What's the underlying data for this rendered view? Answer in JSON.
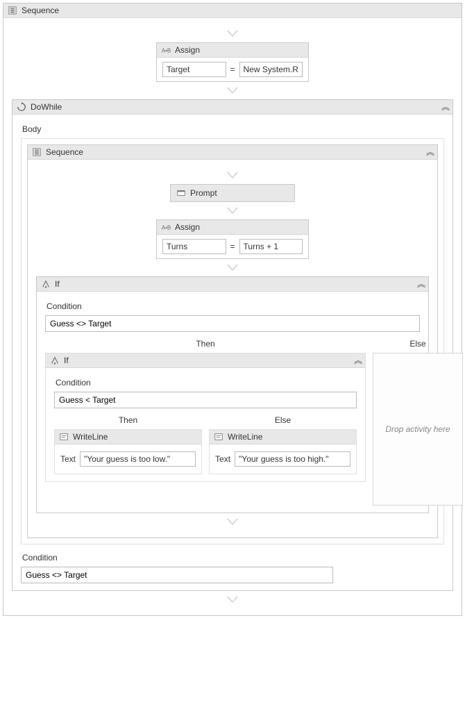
{
  "root": {
    "sequence_title": "Sequence",
    "assign1": {
      "title": "Assign",
      "target": "Target",
      "equals": "=",
      "value": "New System.Rando"
    },
    "dowhile": {
      "title": "DoWhile",
      "body_label": "Body",
      "inner_sequence_title": "Sequence",
      "prompt_title": "Prompt",
      "assign2": {
        "title": "Assign",
        "target": "Turns",
        "equals": "=",
        "value": "Turns + 1"
      },
      "if1": {
        "title": "If",
        "condition_label": "Condition",
        "condition_value": "Guess <> Target",
        "then_label": "Then",
        "else_label": "Else",
        "else_placeholder": "Drop activity here",
        "if2": {
          "title": "If",
          "condition_label": "Condition",
          "condition_value": "Guess < Target",
          "then_label": "Then",
          "else_label": "Else",
          "wl_then": {
            "title": "WriteLine",
            "text_label": "Text",
            "text_value": "\"Your guess is too low.\""
          },
          "wl_else": {
            "title": "WriteLine",
            "text_label": "Text",
            "text_value": "\"Your guess is too high.\""
          }
        }
      },
      "condition_label": "Condition",
      "condition_value": "Guess <> Target"
    }
  }
}
